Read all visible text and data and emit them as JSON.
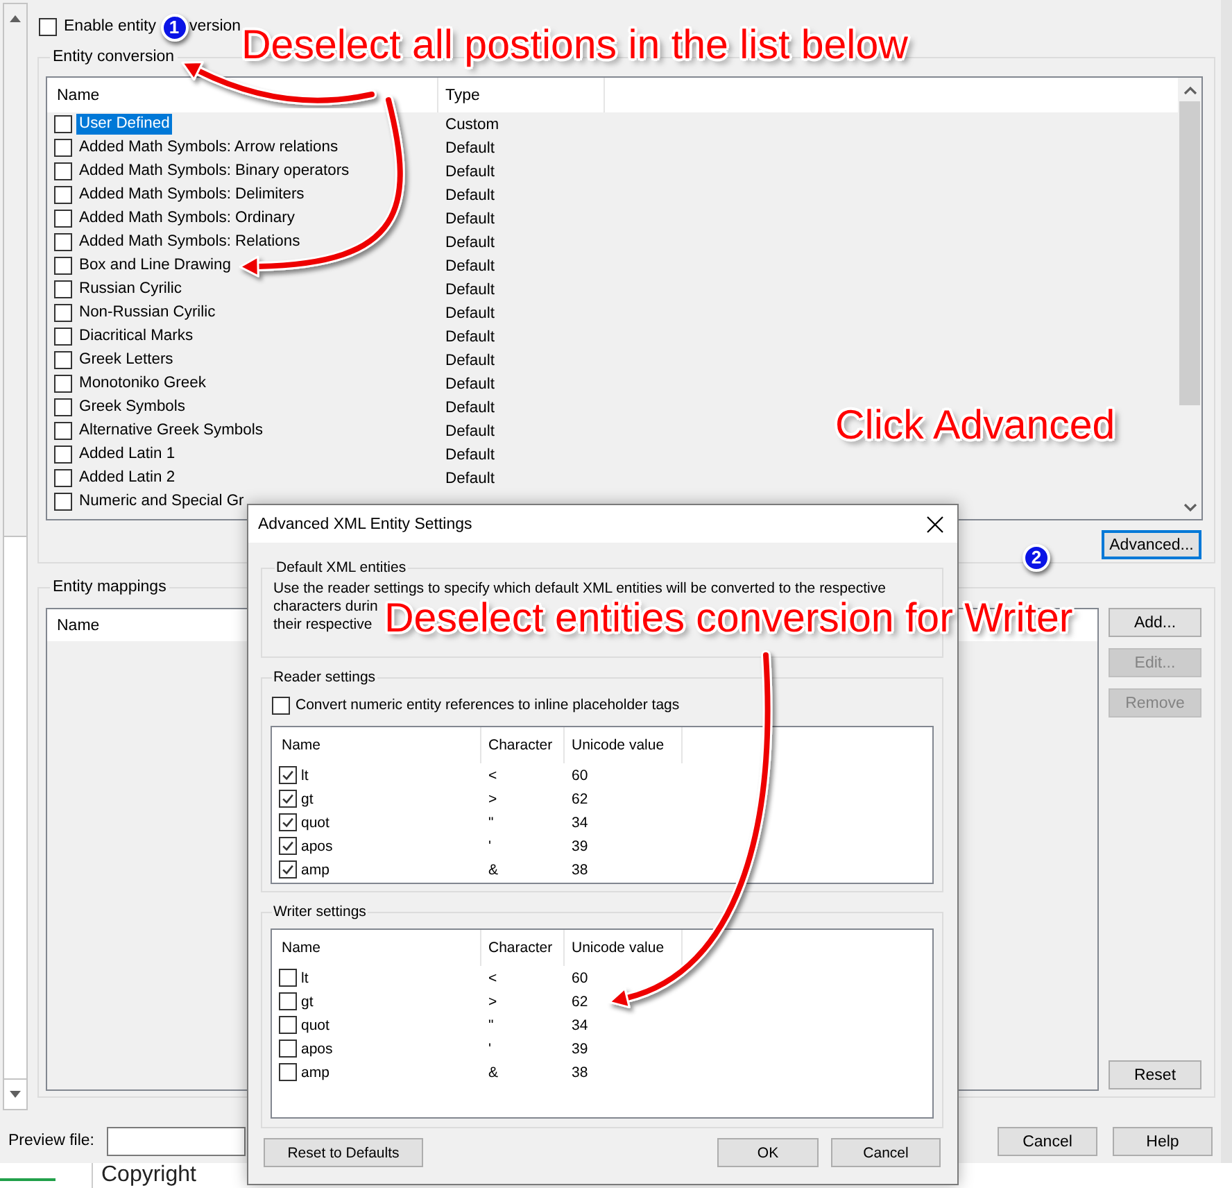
{
  "main_window": {
    "enable_checkbox": {
      "checked": false,
      "label_parts": [
        "Enable entity",
        "version"
      ]
    },
    "conversion": {
      "title": "Entity conversion",
      "columns": [
        "Name",
        "Type"
      ],
      "rows": [
        {
          "name": "User Defined",
          "type": "Custom",
          "checked": false,
          "selected": true
        },
        {
          "name": "Added Math Symbols: Arrow relations",
          "type": "Default",
          "checked": false,
          "selected": false
        },
        {
          "name": "Added Math Symbols: Binary operators",
          "type": "Default",
          "checked": false,
          "selected": false
        },
        {
          "name": "Added Math Symbols: Delimiters",
          "type": "Default",
          "checked": false,
          "selected": false
        },
        {
          "name": "Added Math Symbols: Ordinary",
          "type": "Default",
          "checked": false,
          "selected": false
        },
        {
          "name": "Added Math Symbols: Relations",
          "type": "Default",
          "checked": false,
          "selected": false
        },
        {
          "name": "Box and Line Drawing",
          "type": "Default",
          "checked": false,
          "selected": false
        },
        {
          "name": "Russian Cyrilic",
          "type": "Default",
          "checked": false,
          "selected": false
        },
        {
          "name": "Non-Russian Cyrilic",
          "type": "Default",
          "checked": false,
          "selected": false
        },
        {
          "name": "Diacritical Marks",
          "type": "Default",
          "checked": false,
          "selected": false
        },
        {
          "name": "Greek Letters",
          "type": "Default",
          "checked": false,
          "selected": false
        },
        {
          "name": "Monotoniko Greek",
          "type": "Default",
          "checked": false,
          "selected": false
        },
        {
          "name": "Greek Symbols",
          "type": "Default",
          "checked": false,
          "selected": false
        },
        {
          "name": "Alternative Greek Symbols",
          "type": "Default",
          "checked": false,
          "selected": false
        },
        {
          "name": "Added Latin 1",
          "type": "Default",
          "checked": false,
          "selected": false
        },
        {
          "name": "Added Latin 2",
          "type": "Default",
          "checked": false,
          "selected": false
        },
        {
          "name": "Numeric and Special Gr",
          "checked": false,
          "selected": false
        }
      ],
      "advanced_button": {
        "label": "Advanced...",
        "focused": true
      }
    },
    "mappings": {
      "title": "Entity mappings",
      "columns": [
        "Name"
      ],
      "buttons": [
        {
          "label": "Add...",
          "disabled": false
        },
        {
          "label": "Edit...",
          "disabled": true
        },
        {
          "label": "Remove",
          "disabled": true
        },
        {
          "label": "Reset",
          "disabled": false
        }
      ]
    },
    "footer": {
      "preview_label": "Preview file:",
      "buttons": [
        "Cancel",
        "Help"
      ]
    }
  },
  "background_window": {
    "text": "Copyright"
  },
  "dialog": {
    "title": "Advanced XML Entity Settings",
    "defaults_group": {
      "title": "Default XML entities",
      "description_lines": [
        "Use the reader settings to specify which default XML entities will be converted to the respective",
        "characters durin",
        "their respective"
      ]
    },
    "reader": {
      "title": "Reader settings",
      "numeric_checkbox": {
        "checked": false,
        "label": "Convert numeric entity references to inline placeholder tags"
      },
      "columns": [
        "Name",
        "Character",
        "Unicode value"
      ],
      "rows": [
        {
          "name": "lt",
          "character": "<",
          "unicode_value": "60",
          "checked": true
        },
        {
          "name": "gt",
          "character": ">",
          "unicode_value": "62",
          "checked": true
        },
        {
          "name": "quot",
          "character": "\"",
          "unicode_value": "34",
          "checked": true
        },
        {
          "name": "apos",
          "character": "'",
          "unicode_value": "39",
          "checked": true
        },
        {
          "name": "amp",
          "character": "&",
          "unicode_value": "38",
          "checked": true
        }
      ]
    },
    "writer": {
      "title": "Writer settings",
      "columns": [
        "Name",
        "Character",
        "Unicode value"
      ],
      "rows": [
        {
          "name": "lt",
          "character": "<",
          "unicode_value": "60",
          "checked": false
        },
        {
          "name": "gt",
          "character": ">",
          "unicode_value": "62",
          "checked": false
        },
        {
          "name": "quot",
          "character": "\"",
          "unicode_value": "34",
          "checked": false
        },
        {
          "name": "apos",
          "character": "'",
          "unicode_value": "39",
          "checked": false
        },
        {
          "name": "amp",
          "character": "&",
          "unicode_value": "38",
          "checked": false
        }
      ]
    },
    "reset_button": "Reset to Defaults",
    "ok_button": "OK",
    "cancel_button": "Cancel"
  },
  "annotations": {
    "callouts": [
      {
        "text": "Deselect all postions in the list below"
      },
      {
        "text": "Click Advanced"
      },
      {
        "text": "Deselect entities conversion for Writer"
      }
    ],
    "badges": [
      "1",
      "2"
    ]
  }
}
